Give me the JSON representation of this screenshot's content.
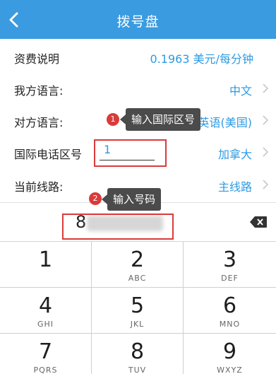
{
  "header": {
    "title": "拨号盘"
  },
  "rows": {
    "rate": {
      "label": "资费说明",
      "value": "0.1963 美元/每分钟"
    },
    "my_language": {
      "label": "我方语言:",
      "value": "中文"
    },
    "other_language": {
      "label": "对方语言:",
      "value": "英语(美国)"
    },
    "area_code": {
      "label": "国际电话区号",
      "input_value": "1",
      "country": "加拿大"
    },
    "line": {
      "label": "当前线路:",
      "value": "主线路"
    }
  },
  "annotations": {
    "tip1": {
      "badge": "1",
      "text": "输入国际区号"
    },
    "tip2": {
      "badge": "2",
      "text": "输入号码"
    }
  },
  "dial": {
    "number_visible": "8"
  },
  "keypad": [
    {
      "digit": "1",
      "letters": ""
    },
    {
      "digit": "2",
      "letters": "ABC"
    },
    {
      "digit": "3",
      "letters": "DEF"
    },
    {
      "digit": "4",
      "letters": "GHI"
    },
    {
      "digit": "5",
      "letters": "JKL"
    },
    {
      "digit": "6",
      "letters": "MNO"
    },
    {
      "digit": "7",
      "letters": "PQRS"
    },
    {
      "digit": "8",
      "letters": "TUV"
    },
    {
      "digit": "9",
      "letters": "WXYZ"
    }
  ],
  "colors": {
    "header": "#3a9be0",
    "accent": "#2d9be3",
    "annotation_red": "#d93b3b",
    "tooltip_bg": "#4b4b4b"
  },
  "icons": {
    "back": "back-chevron-icon",
    "row_arrow": "chevron-right-icon",
    "delete": "backspace-icon"
  }
}
